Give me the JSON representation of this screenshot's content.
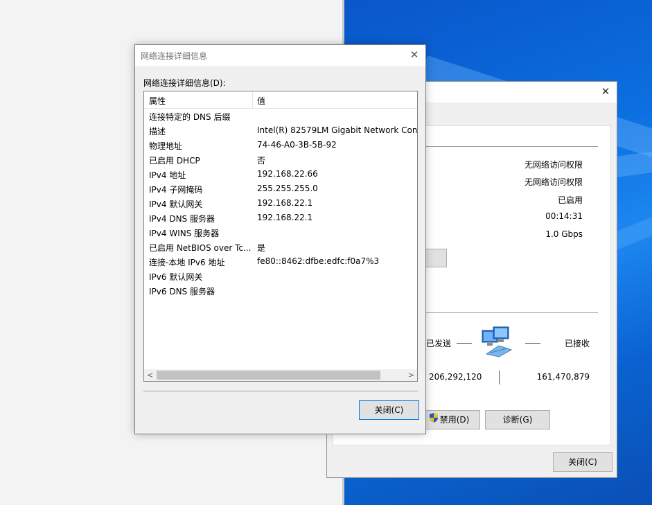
{
  "details_dialog": {
    "title": "网络连接详细信息",
    "list_label": "网络连接详细信息(D):",
    "columns": {
      "property": "属性",
      "value": "值"
    },
    "rows": [
      {
        "property": "连接特定的 DNS 后缀",
        "value": ""
      },
      {
        "property": "描述",
        "value": "Intel(R) 82579LM Gigabit Network Conn"
      },
      {
        "property": "物理地址",
        "value": "74-46-A0-3B-5B-92"
      },
      {
        "property": "已启用 DHCP",
        "value": "否"
      },
      {
        "property": "IPv4 地址",
        "value": "192.168.22.66"
      },
      {
        "property": "IPv4 子网掩码",
        "value": "255.255.255.0"
      },
      {
        "property": "IPv4 默认网关",
        "value": "192.168.22.1"
      },
      {
        "property": "IPv4 DNS 服务器",
        "value": "192.168.22.1"
      },
      {
        "property": "IPv4 WINS 服务器",
        "value": ""
      },
      {
        "property": "已启用 NetBIOS over Tc...",
        "value": "是"
      },
      {
        "property": "连接-本地 IPv6 地址",
        "value": "fe80::8462:dfbe:edfc:f0a7%3"
      },
      {
        "property": "IPv6 默认网关",
        "value": ""
      },
      {
        "property": "IPv6 DNS 服务器",
        "value": ""
      }
    ],
    "close_button": "关闭(C)"
  },
  "status_window": {
    "connection": {
      "ipv4_connectivity": "无网络访问权限",
      "ipv6_connectivity": "无网络访问权限",
      "media_state": "已启用",
      "duration": "00:14:31",
      "speed": "1.0 Gbps"
    },
    "activity": {
      "sent_label": "已发送",
      "received_label": "已接收",
      "sent_bytes": "206,292,120",
      "received_bytes": "161,470,879"
    },
    "disable_button": "禁用(D)",
    "diagnose_button": "诊断(G)",
    "close_button": "关闭(C)"
  },
  "colors": {
    "desktop_blue": "#0b6fe0",
    "accent": "#0078d7"
  },
  "icons": {
    "close": "close-icon",
    "network": "network-computers-icon",
    "shield": "uac-shield-icon"
  }
}
